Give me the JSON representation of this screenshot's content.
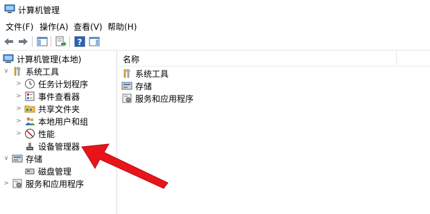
{
  "window": {
    "title": "计算机管理"
  },
  "menu": [
    "文件(F)",
    "操作(A)",
    "查看(V)",
    "帮助(H)"
  ],
  "tree": {
    "root": "计算机管理(本地)",
    "system_tools": "系统工具",
    "task_scheduler": "任务计划程序",
    "event_viewer": "事件查看器",
    "shared_folders": "共享文件夹",
    "local_users": "本地用户和组",
    "performance": "性能",
    "device_manager": "设备管理器",
    "storage": "存储",
    "disk_management": "磁盘管理",
    "services_apps": "服务和应用程序"
  },
  "list": {
    "column_name": "名称",
    "items": [
      "系统工具",
      "存储",
      "服务和应用程序"
    ]
  },
  "colors": {
    "annotation_arrow": "#e8141a",
    "tool_yellow": "#e4b32a"
  },
  "icons": {
    "toolbar": [
      "back-arrow-icon",
      "forward-arrow-icon",
      "show-hide-tree-icon",
      "export-list-icon",
      "help-icon",
      "console-pane-icon"
    ]
  }
}
